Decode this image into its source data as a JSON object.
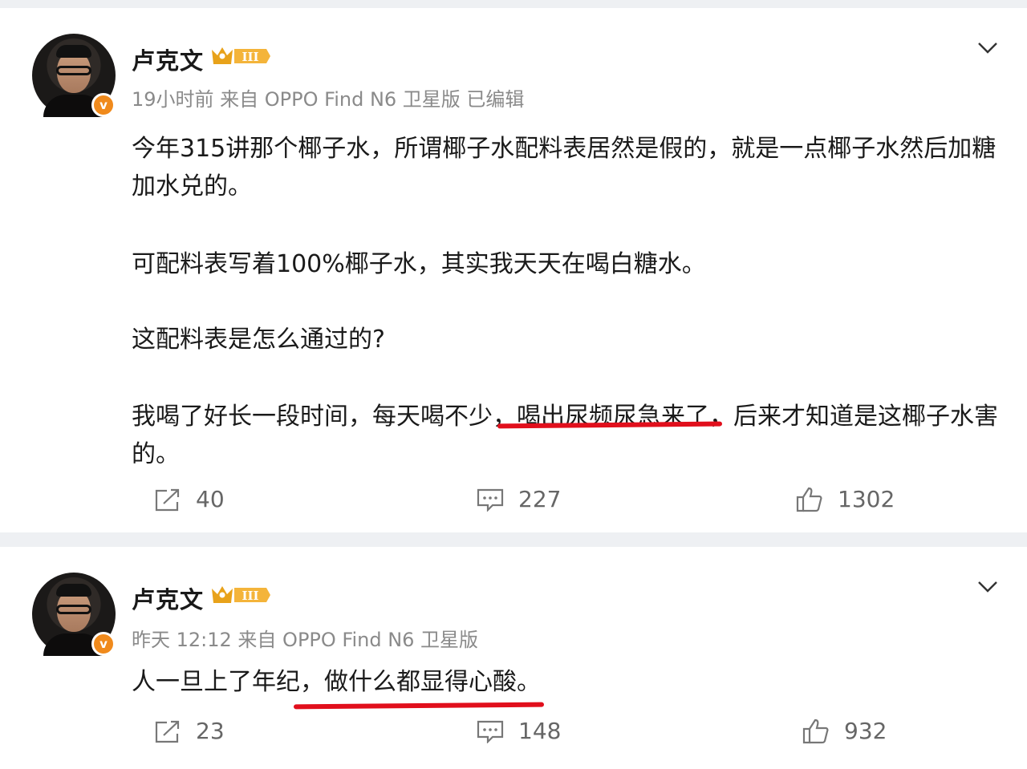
{
  "posts": [
    {
      "author": "卢克文",
      "level_badge": "III",
      "meta": "19小时前 来自 OPPO Find N6 卫星版 已编辑",
      "paragraphs": [
        "今年315讲那个椰子水，所谓椰子水配料表居然是假的，就是一点椰子水然后加糖加水兑的。",
        "可配料表写着100%椰子水，其实我天天在喝白糖水。",
        "这配料表是怎么通过的?",
        "我喝了好长一段时间，每天喝不少，喝出尿频尿急来了，后来才知道是这椰子水害的。"
      ],
      "shares": "40",
      "comments": "227",
      "likes": "1302"
    },
    {
      "author": "卢克文",
      "level_badge": "III",
      "meta": "昨天 12:12 来自 OPPO Find N6 卫星版",
      "paragraphs": [
        "人一旦上了年纪，做什么都显得心酸。"
      ],
      "shares": "23",
      "comments": "148",
      "likes": "932"
    }
  ],
  "icons": {
    "verified": "v-badge-icon",
    "share": "share-icon",
    "comment": "comment-icon",
    "like": "thumbs-up-icon",
    "menu": "chevron-down-icon"
  },
  "colors": {
    "underline": "#e10f1c",
    "verified": "#f08a1c",
    "crown": "#e8a21a"
  }
}
